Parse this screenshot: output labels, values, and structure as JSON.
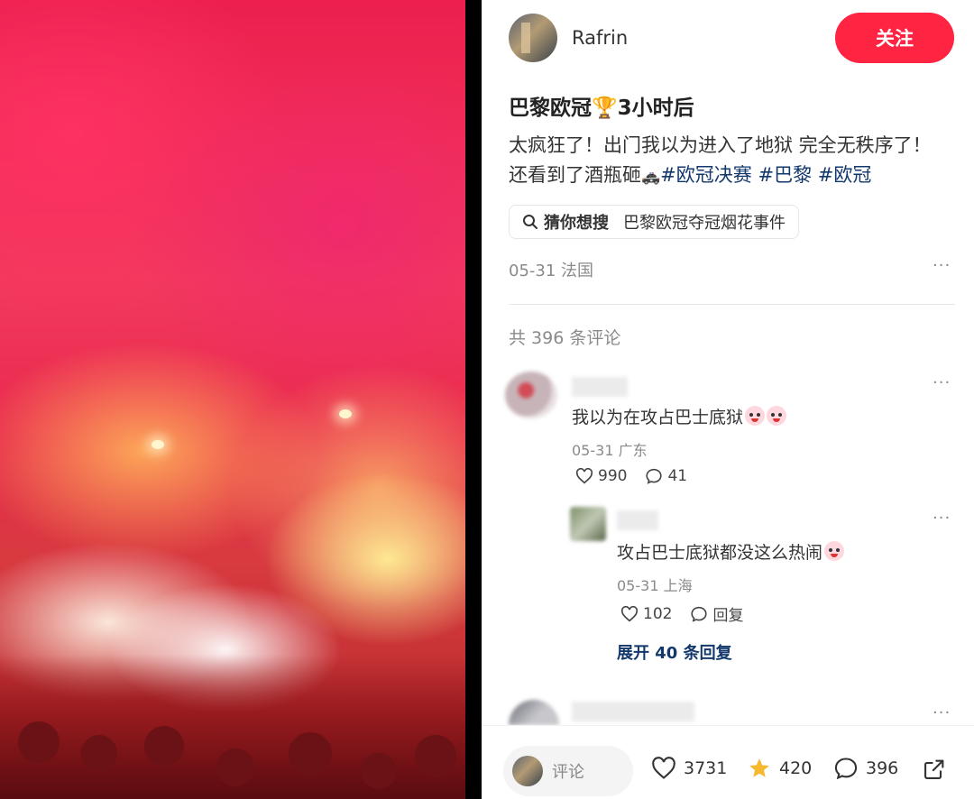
{
  "author": {
    "name": "Rafrin",
    "follow_label": "关注"
  },
  "post": {
    "title": "巴黎欧冠🏆3小时后",
    "body_line1": "太疯狂了！出门我以为进入了地狱 完全无秩序了！",
    "body_line2_text": "还看到了酒瓶砸",
    "body_line2_emoji": "🚓",
    "tags": [
      "#欧冠决赛",
      "#巴黎",
      "#欧冠"
    ],
    "search_label": "猜你想搜",
    "search_query": "巴黎欧冠夺冠烟花事件",
    "meta": "05-31 法国",
    "more": "···"
  },
  "comments": {
    "count_label": "共 396 条评论",
    "items": [
      {
        "text": "我以为在攻占巴士底狱",
        "meta": "05-31 广东",
        "likes": "990",
        "replies": "41",
        "more": "···"
      }
    ],
    "reply": {
      "text": "攻占巴士底狱都没这么热闹",
      "meta": "05-31 上海",
      "likes": "102",
      "reply_label": "回复",
      "more": "···"
    },
    "expand_label": "展开 40 条回复",
    "third_more": "···"
  },
  "bottom_bar": {
    "comment_placeholder": "评论",
    "likes": "3731",
    "favorites": "420",
    "comments": "396"
  },
  "colors": {
    "accent": "#ff2442",
    "tag": "#13386c",
    "star": "#f5b82e"
  }
}
